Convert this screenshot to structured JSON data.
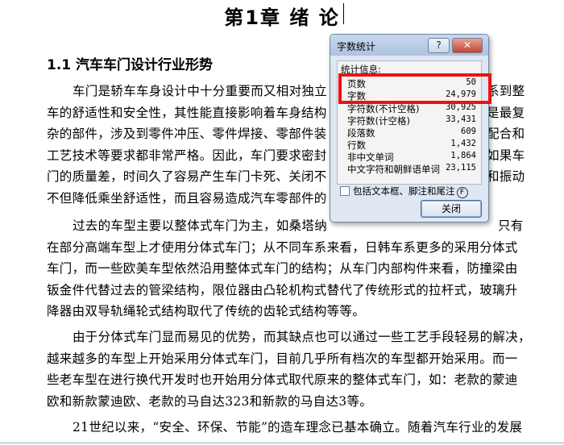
{
  "document": {
    "chapter_title": "第1章 绪  论",
    "section_title": "1.1 汽车车门设计行业形势",
    "paragraphs": [
      {
        "lines": [
          "车门是轿车车身设计中十分重要而又相对独立",
          "车的舒适性和安全性，其性能直接影响着车身结构",
          "杂的部件，涉及到零件冲压、零件焊接、零部件装",
          "工艺技术等要求都非常严格。因此，车门要求密封",
          "门的质量差，时间久了容易产生车门卡死、关闭不",
          "不但降低乘坐舒适性，而且容易造成汽车零部件的"
        ]
      },
      {
        "lines": [
          "过去的车型主要以整体式车门为主，如桑塔纳",
          "在部分高端车型上才使用分体式车门；从不同车系来看，日韩车系更多的采用分体式",
          "车门，而一些欧美车型依然沿用整体式车门的结构；从车门内部构件来看，防撞梁由",
          "钣金件代替过去的管梁结构，限位器由凸轮机构式替代了传统形式的拉杆式，玻璃升",
          "降器由双导轨绳轮式结构取代了传统的齿轮式结构等等。"
        ]
      },
      {
        "lines": [
          "由于分体式车门显而易见的优势，而其缺点也可以通过一些工艺手段轻易的解决，",
          "越来越多的车型上开始采用分体式车门，目前几乎所有档次的车型都开始采用。而一",
          "些老车型在进行换代开发时也开始用分体式取代原来的整体式车门，如：老款的蒙迪",
          "欧和新款蒙迪欧、老款的马自达323和新款的马自达3等。"
        ]
      },
      {
        "lines": [
          "21世纪以来，“安全、环保、节能”的造车理念已基本确立。随着汽车行业的发展，"
        ]
      }
    ],
    "right_fragments": [
      "系到整",
      "是最复",
      "配合和",
      "如果车",
      "和振动",
      "只有"
    ]
  },
  "dialog": {
    "title": "字数统计",
    "help_label": "?",
    "close_label": "✕",
    "heading": "统计信息:",
    "stats": [
      {
        "label": "页数",
        "value": "50"
      },
      {
        "label": "字数",
        "value": "24,979"
      },
      {
        "label": "字符数(不计空格)",
        "value": "30,925"
      },
      {
        "label": "字符数(计空格)",
        "value": "33,431"
      },
      {
        "label": "段落数",
        "value": "609"
      },
      {
        "label": "行数",
        "value": "1,432"
      },
      {
        "label": "非中文单词",
        "value": "1,864"
      },
      {
        "label": "中文字符和朝鲜语单词",
        "value": "23,115"
      }
    ],
    "checkbox_label": "包括文本框、脚注和尾注",
    "checkbox_help": "F",
    "button_label": "关闭"
  },
  "colors": {
    "highlight": "#ee1111",
    "dialog_bg": "#dfe7f3"
  }
}
